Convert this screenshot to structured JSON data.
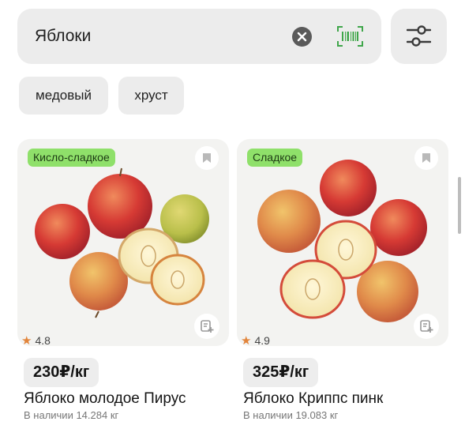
{
  "search": {
    "value": "Яблоки"
  },
  "chips": [
    "медовый",
    "хруст"
  ],
  "products": [
    {
      "tag": "Кисло-сладкое",
      "rating": "4.8",
      "price": "230₽/кг",
      "title": "Яблоко молодое Пирус",
      "stock": "В наличии 14.284 кг"
    },
    {
      "tag": "Сладкое",
      "rating": "4.9",
      "price": "325₽/кг",
      "title": "Яблоко Криппс пинк",
      "stock": "В наличии 19.083 кг"
    }
  ],
  "icons": {
    "clear": "clear-icon",
    "barcode": "barcode-icon",
    "filter": "filter-icon",
    "bookmark": "bookmark-icon",
    "add_to_list": "add-to-list-icon",
    "star": "star-icon"
  },
  "colors": {
    "tag_bg": "#8fe06a",
    "barcode": "#3fa64a",
    "star": "#e2843a",
    "surface": "#ececec"
  }
}
